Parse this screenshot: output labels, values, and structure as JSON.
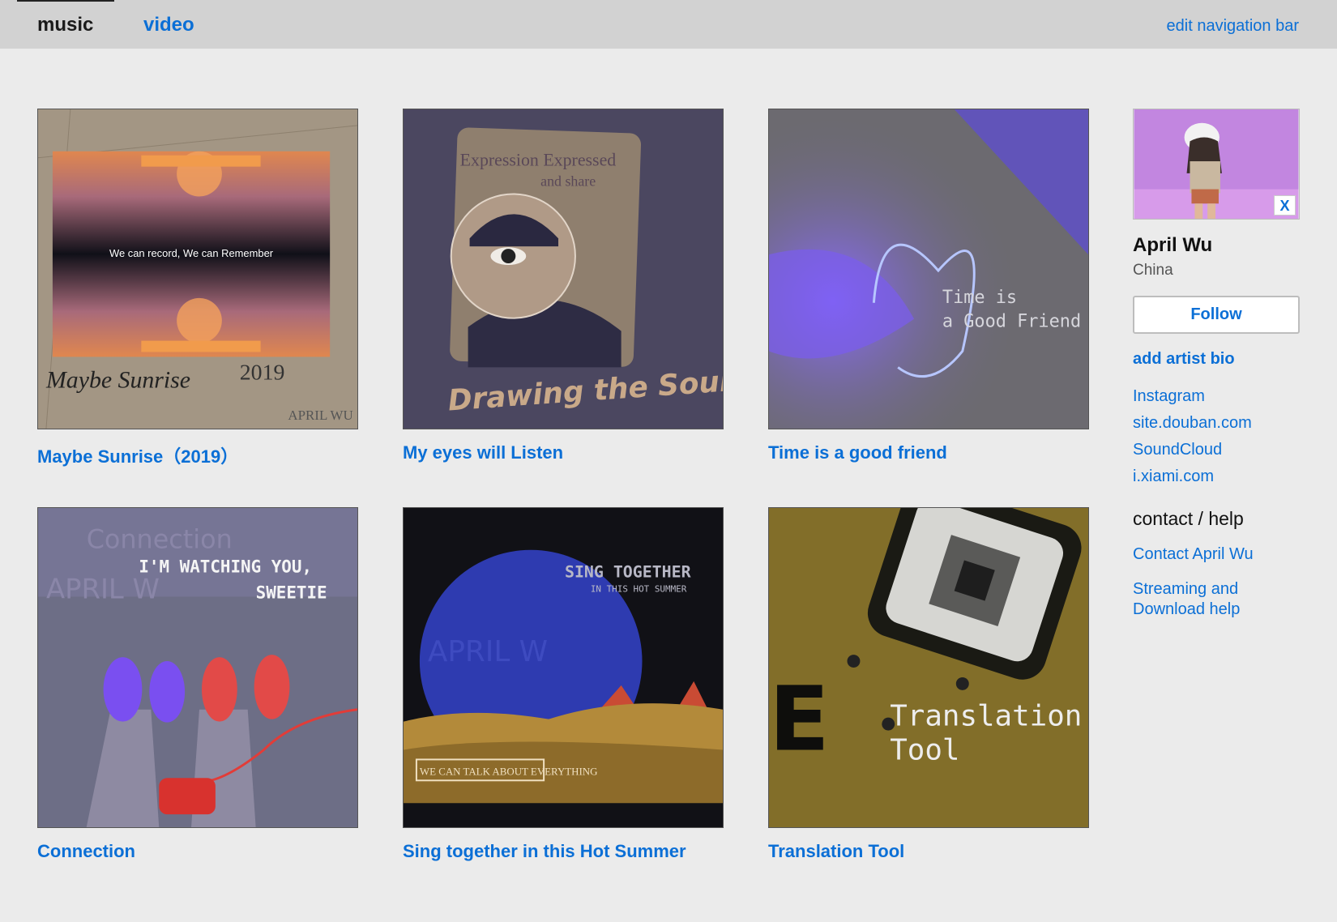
{
  "nav": {
    "tabs": [
      {
        "label": "music",
        "active": true
      },
      {
        "label": "video",
        "active": false
      }
    ],
    "edit_label": "edit navigation bar"
  },
  "albums": [
    {
      "title": "Maybe Sunrise（2019）",
      "cover_text": [
        "We can record, We can Remember",
        "Maybe Sunrise",
        "2019",
        "APRIL WU"
      ]
    },
    {
      "title": "My eyes will Listen",
      "cover_text": [
        "Expression Expressed",
        "and share",
        "Drawing the Sound"
      ]
    },
    {
      "title": "Time is a good friend",
      "cover_text": [
        "Time is",
        "a Good Friend"
      ]
    },
    {
      "title": "Connection",
      "cover_text": [
        "Connection",
        "I'M WATCHING YOU,",
        "SWEETIE",
        "APRIL W"
      ]
    },
    {
      "title": "Sing together in this Hot Summer",
      "cover_text": [
        "SING TOGETHER",
        "IN THIS HOT SUMMER",
        "APRIL W",
        "WE CAN TALK ABOUT EVERYTHING"
      ]
    },
    {
      "title": "Translation Tool",
      "cover_text": [
        "Translation",
        "Tool",
        "E"
      ]
    }
  ],
  "artist": {
    "name": "April Wu",
    "location": "China",
    "follow_label": "Follow",
    "add_bio_label": "add artist bio",
    "remove_photo_label": "X",
    "links": [
      "Instagram",
      "site.douban.com",
      "SoundCloud",
      "i.xiami.com"
    ],
    "contact_heading": "contact / help",
    "contact_label": "Contact April Wu",
    "help_label": "Streaming and Download help"
  },
  "colors": {
    "link": "#0b6fd6",
    "topbar": "#d2d2d2",
    "background": "#ebebeb"
  }
}
